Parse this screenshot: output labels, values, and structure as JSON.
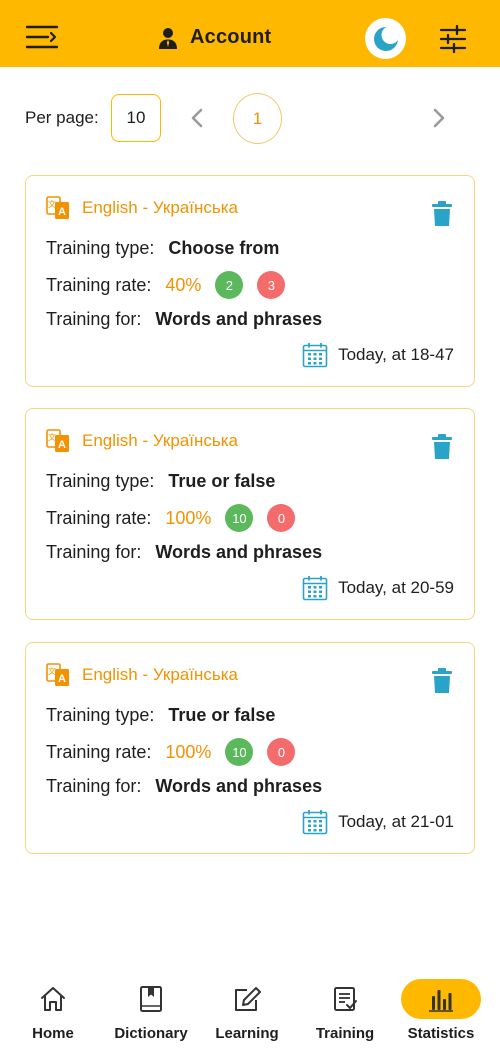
{
  "header": {
    "title": "Account",
    "accent": "#ffb800",
    "icons": {
      "menu": "menu-icon",
      "account": "user-icon",
      "theme": "moon-icon",
      "filter": "filter-icon"
    }
  },
  "pagination": {
    "per_page_label": "Per page:",
    "per_page_value": "10",
    "current_page": "1"
  },
  "cards": [
    {
      "language": "English - Українська",
      "type_label": "Training type:",
      "type_value": "Choose from",
      "rate_label": "Training rate:",
      "rate_value": "40%",
      "correct": "2",
      "wrong": "3",
      "for_label": "Training for:",
      "for_value": "Words and phrases",
      "date": "Today, at 18-47"
    },
    {
      "language": "English - Українська",
      "type_label": "Training type:",
      "type_value": "True or false",
      "rate_label": "Training rate:",
      "rate_value": "100%",
      "correct": "10",
      "wrong": "0",
      "for_label": "Training for:",
      "for_value": "Words and phrases",
      "date": "Today, at 20-59"
    },
    {
      "language": "English - Українська",
      "type_label": "Training type:",
      "type_value": "True or false",
      "rate_label": "Training rate:",
      "rate_value": "100%",
      "correct": "10",
      "wrong": "0",
      "for_label": "Training for:",
      "for_value": "Words and phrases",
      "date": "Today, at 21-01"
    }
  ],
  "nav": {
    "items": [
      {
        "label": "Home",
        "icon": "home-icon"
      },
      {
        "label": "Dictionary",
        "icon": "book-icon"
      },
      {
        "label": "Learning",
        "icon": "edit-icon"
      },
      {
        "label": "Training",
        "icon": "checklist-icon"
      },
      {
        "label": "Statistics",
        "icon": "bar-chart-icon",
        "active": true
      }
    ]
  }
}
